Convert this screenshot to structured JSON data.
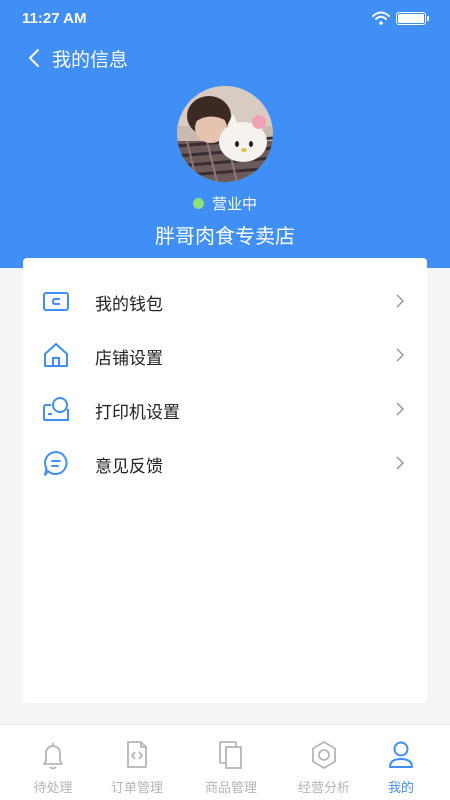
{
  "status_bar": {
    "time": "11:27 AM"
  },
  "nav": {
    "title": "我的信息"
  },
  "profile": {
    "status_text": "营业中",
    "status_color": "#8ee07d",
    "shop_name": "胖哥肉食专卖店"
  },
  "menu": [
    {
      "label": "我的钱包",
      "icon": "wallet-icon"
    },
    {
      "label": "店铺设置",
      "icon": "home-icon"
    },
    {
      "label": "打印机设置",
      "icon": "printer-icon"
    },
    {
      "label": "意见反馈",
      "icon": "feedback-icon"
    }
  ],
  "tabs": [
    {
      "label": "待处理",
      "icon": "bell-icon",
      "active": false
    },
    {
      "label": "订单管理",
      "icon": "order-icon",
      "active": false
    },
    {
      "label": "商品管理",
      "icon": "products-icon",
      "active": false
    },
    {
      "label": "经营分析",
      "icon": "hexagon-icon",
      "active": false
    },
    {
      "label": "我的",
      "icon": "user-icon",
      "active": true
    }
  ],
  "colors": {
    "brand": "#3f8ff7",
    "inactive": "#b5b5b5"
  }
}
